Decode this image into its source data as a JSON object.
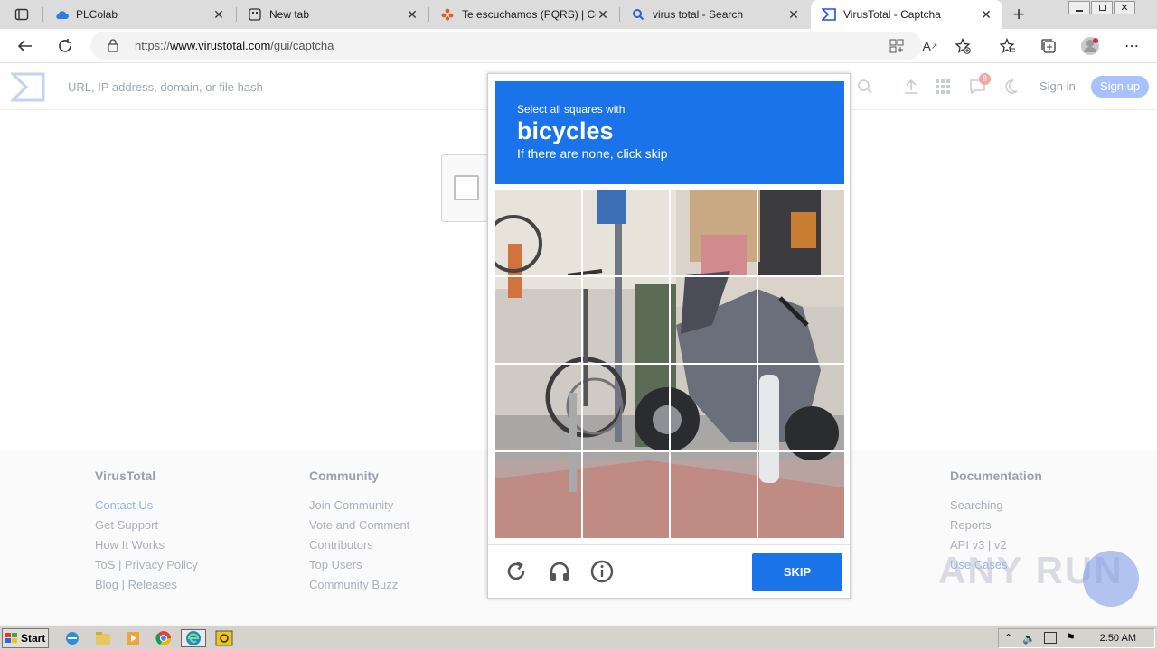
{
  "browser": {
    "tabs": [
      {
        "label": "PLColab",
        "icon": "cloud-icon"
      },
      {
        "label": "New tab",
        "icon": "newtab-icon"
      },
      {
        "label": "Te escuchamos (PQRS) | Cor",
        "icon": "flower-icon"
      },
      {
        "label": "virus total - Search",
        "icon": "search-icon"
      },
      {
        "label": "VirusTotal - Captcha",
        "icon": "virustotal-icon"
      }
    ],
    "new_tab_symbol": "+",
    "url_prefix": "https://",
    "url_host": "www.virustotal.com",
    "url_path": "/gui/captcha"
  },
  "vt_header": {
    "search_placeholder": "URL, IP address, domain, or file hash",
    "notification_count": "8",
    "signin_label": "Sign in",
    "signup_label": "Sign up"
  },
  "footer": {
    "columns": [
      {
        "title": "VirusTotal",
        "links": [
          "Contact Us",
          "Get Support",
          "How It Works",
          "ToS | Privacy Policy",
          "Blog | Releases"
        ]
      },
      {
        "title": "Community",
        "links": [
          "Join Community",
          "Vote and Comment",
          "Contributors",
          "Top Users",
          "Community Buzz"
        ]
      },
      {
        "title": "Documentation",
        "links": [
          "Searching",
          "Reports",
          "API v3 | v2",
          "Use Cases"
        ]
      }
    ]
  },
  "captcha": {
    "instruction_line1": "Select all squares with",
    "target_object": "bicycles",
    "instruction_line3": "If there are none, click skip",
    "skip_label": "SKIP",
    "grid_size": 4
  },
  "watermark": "ANY RUN",
  "taskbar": {
    "start_label": "Start",
    "clock": "2:50 AM"
  },
  "colors": {
    "captcha_blue": "#1a73e8",
    "tab_bg": "#dcdcdc"
  }
}
